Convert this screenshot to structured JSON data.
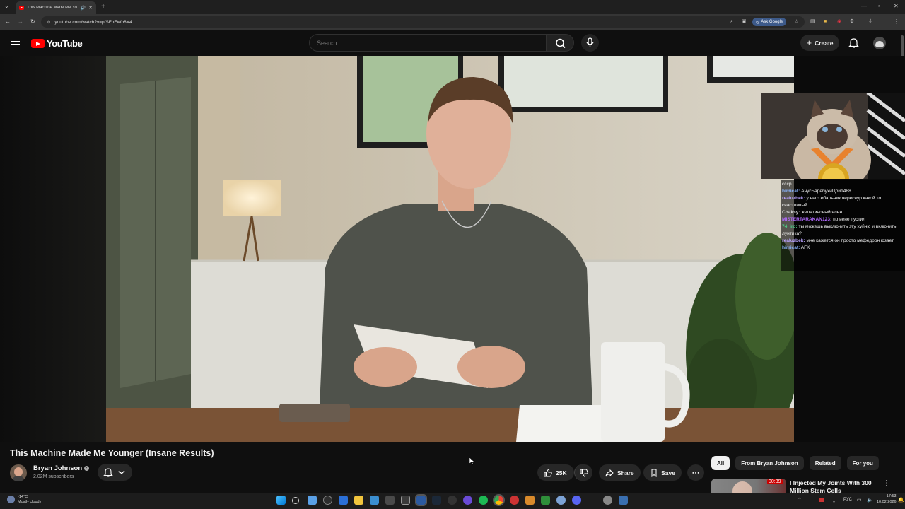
{
  "browser": {
    "tab_title": "This Machine Made Me Yo...",
    "url": "youtube.com/watch?v=pfSFnFWb8X4",
    "ask_google": "Ask Google"
  },
  "masthead": {
    "logo_text": "YouTube",
    "search_placeholder": "Search",
    "create_label": "Create"
  },
  "overlay": {
    "chat": [
      {
        "user": "",
        "text": "сссp",
        "color": "#ffffff"
      },
      {
        "user": "himicat:",
        "text": "АнусБаребухиЦой1488",
        "color": "#8ab4ff"
      },
      {
        "user": "realuzbek:",
        "text": "у него ебальник чересчур какой то счастливый",
        "color": "#b9a3ff"
      },
      {
        "user": "Chaksy:",
        "text": "желатиновый член",
        "color": "#d4d4d4"
      },
      {
        "user": "MISTERTARAKAN123:",
        "text": "по вене пустил",
        "color": "#b36bff"
      },
      {
        "user": "74_iro:",
        "text": "ты можешь выключить эту хуйню и включить лунтика?",
        "color": "#4ed18a"
      },
      {
        "user": "realuzbek:",
        "text": "мне кажется он просто мефедрон юзает",
        "color": "#b9a3ff"
      },
      {
        "user": "himicat:",
        "text": "AFK",
        "color": "#8ab4ff"
      }
    ]
  },
  "video": {
    "title": "This Machine Made Me Younger (Insane Results)",
    "channel": "Bryan Johnson",
    "subscribers": "2.02M subscribers",
    "likes": "25K",
    "share_label": "Share",
    "save_label": "Save"
  },
  "chips": [
    "All",
    "From Bryan Johnson",
    "Related",
    "For you"
  ],
  "recommendation": {
    "duration": "00:39",
    "title": "I Injected My Joints With 300 Million Stem Cells"
  },
  "taskbar": {
    "temp": "-14°C",
    "weather": "Mostly cloudy",
    "lang": "РУС",
    "time": "17:53",
    "date": "10.02.2026"
  },
  "colors": {
    "brand_red": "#ff0000",
    "bg": "#0f0f0f"
  }
}
